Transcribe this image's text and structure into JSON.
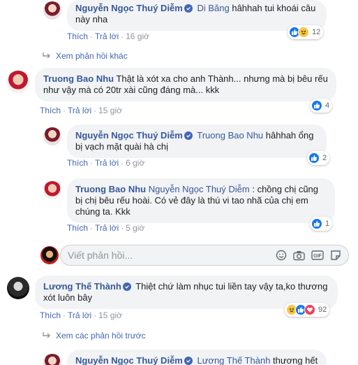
{
  "comments": [
    {
      "author": "Nguyễn Ngọc Thuý Diễm",
      "mention": "Di Băng",
      "text": " hâhhah tui khoái câu này nha",
      "like_label": "Thích",
      "reply_label": "Trả lời",
      "time": "16 giờ",
      "reaction_count": "12"
    },
    {
      "author": "Truong Bao Nhu",
      "text": " Thật là xót xa cho anh Thành... nhưng mà bị bêu rếu như vậy mà có 20tr xài cũng đáng mà... kkk",
      "like_label": "Thích",
      "reply_label": "Trả lời",
      "time": "15 giờ",
      "reaction_count": "4"
    },
    {
      "author": "Nguyễn Ngọc Thuý Diễm",
      "mention": "Truong Bao Nhu",
      "text": " hâhhah ổng bị vạch mặt quài hà chị",
      "like_label": "Thích",
      "reply_label": "Trả lời",
      "time": "6 giờ",
      "reaction_count": "2"
    },
    {
      "author": "Truong Bao Nhu",
      "mention": "Nguyễn Ngọc Thuý Diễm",
      "text": " : chồng chị cũng bị chị bêu rếu hoài. Có vẻ đây là thú vi tao nhã của chị em chúng ta. Kkk",
      "like_label": "Thích",
      "reply_label": "Trả lời",
      "time": "5 giờ",
      "reaction_count": "1"
    },
    {
      "author": "Lương Thế Thành",
      "text": " Thiệt chứ làm nhục tui liền tay vậy ta,ko thương xót luôn bây",
      "like_label": "Thích",
      "reply_label": "Trả lời",
      "time": "15 giờ",
      "reaction_count": "92"
    },
    {
      "author": "Nguyễn Ngọc Thuý Diễm",
      "mention": "Lương Thế Thành",
      "text": " thương hết xức"
    }
  ],
  "more_replies_1": "Xem phản hồi khác",
  "more_replies_2": "Xem các phản hồi trước",
  "composer": {
    "placeholder": "Viết phản hồi..."
  },
  "icons": {
    "verified": "verified-badge-icon",
    "reply_arrow": "reply-arrow-icon",
    "emoji": "emoji-icon",
    "camera": "camera-icon",
    "gif": "gif-icon",
    "sticker": "sticker-icon"
  },
  "colors": {
    "link": "#385898",
    "like": "#1877f2",
    "bubble": "#f2f3f5",
    "haha": "#f7c744",
    "love": "#f33e58"
  }
}
